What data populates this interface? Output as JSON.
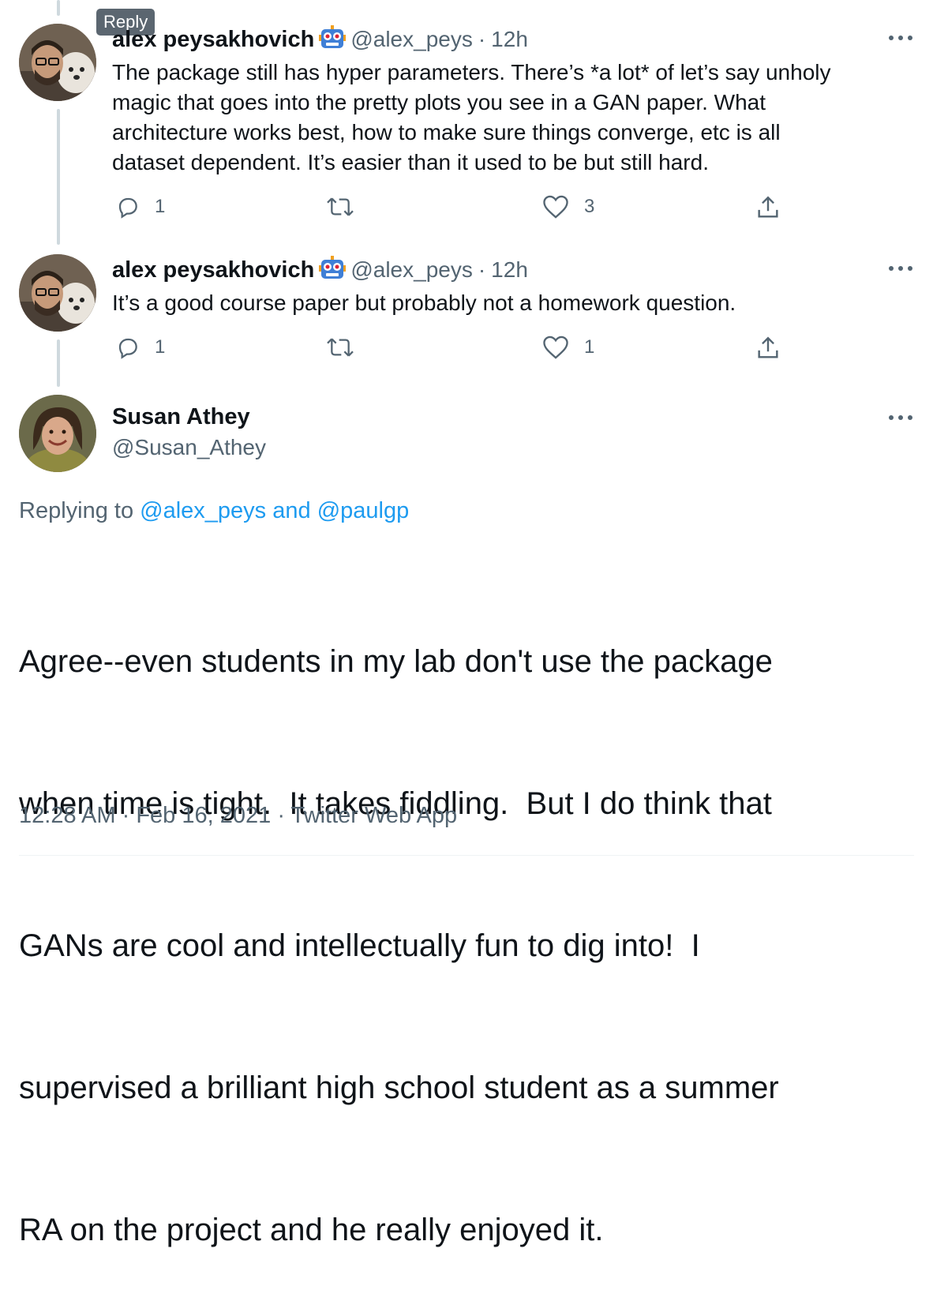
{
  "tooltip": "Reply",
  "replies": [
    {
      "name": "alex peysakhovich",
      "handle": "@alex_peys",
      "sep": "·",
      "time": "12h",
      "text_lines": [
        "The package still has hyper parameters. There’s *a lot* of let’s say unholy",
        "magic that goes into the pretty plots you see in a GAN paper. What",
        "architecture works best, how to make sure things converge, etc is all",
        "dataset dependent. It’s easier than it used to be but still hard."
      ],
      "reply_count": "1",
      "retweet_count": "",
      "like_count": "3"
    },
    {
      "name": "alex peysakhovich",
      "handle": "@alex_peys",
      "sep": "·",
      "time": "12h",
      "text_lines": [
        "It’s a good course paper but probably not a homework question."
      ],
      "reply_count": "1",
      "retweet_count": "",
      "like_count": "1"
    }
  ],
  "main": {
    "name": "Susan Athey",
    "handle": "@Susan_Athey",
    "replying_prefix": "Replying to",
    "replying_user1": "@alex_peys",
    "replying_and": "and",
    "replying_user2": "@paulgp",
    "text_lines": [
      "Agree--even students in my lab don't use the package",
      "when time is tight.  It takes fiddling.  But I do think that",
      "GANs are cool and intellectually fun to dig into!  I",
      "supervised a brilliant high school student as a summer",
      "RA on the project and he really enjoyed it."
    ],
    "time": "12:28 AM",
    "sep1": "·",
    "date": "Feb 16, 2021",
    "sep2": "·",
    "source": "Twitter Web App"
  },
  "colors": {
    "link": "#1d9bf0",
    "secondary_text": "#536471",
    "thread_line": "#cfd9de"
  }
}
